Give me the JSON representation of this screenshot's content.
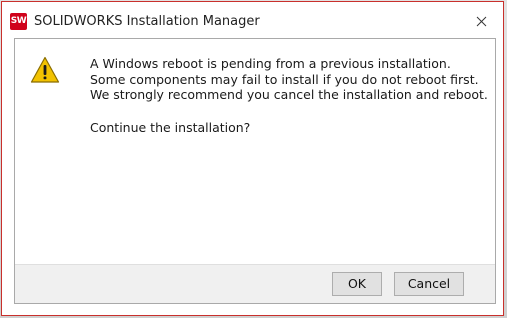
{
  "window": {
    "title": "SOLIDWORKS Installation Manager",
    "app_icon_text": "SW",
    "close_icon": "close-icon"
  },
  "dialog": {
    "icon": "warning-icon",
    "message": "A Windows reboot is pending from a previous installation. Some components may fail to install if you do not reboot first. We strongly recommend you cancel the installation and reboot.",
    "question": "Continue the installation?"
  },
  "buttons": {
    "ok_label": "OK",
    "cancel_label": "Cancel"
  },
  "colors": {
    "frame_border": "#c9302c",
    "app_icon_bg": "#d0021b",
    "warning_fill": "#f2c200"
  }
}
